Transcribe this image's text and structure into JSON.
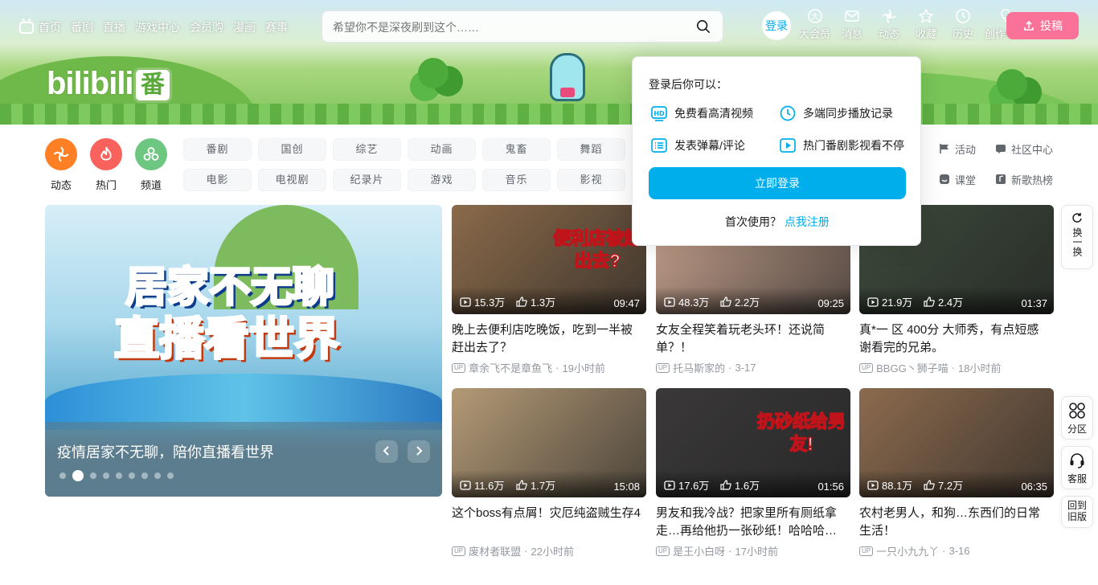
{
  "nav": {
    "left_items": [
      "首页",
      "番剧",
      "直播",
      "游戏中心",
      "会员购",
      "漫画",
      "赛事"
    ],
    "search_placeholder": "希望你不是深夜刷到这个……",
    "login_avatar": "登录",
    "right_items": [
      {
        "label": "大会员",
        "icon": "vip-icon"
      },
      {
        "label": "消息",
        "icon": "message-icon"
      },
      {
        "label": "动态",
        "icon": "dynamic-icon"
      },
      {
        "label": "收藏",
        "icon": "favorite-icon"
      },
      {
        "label": "历史",
        "icon": "history-icon"
      },
      {
        "label": "创作中心",
        "icon": "creator-center-icon"
      }
    ],
    "upload_label": "投稿"
  },
  "logo": {
    "text": "bilibili",
    "badge": "番"
  },
  "channels": {
    "round": [
      {
        "label": "动态",
        "color": "#ff7f24",
        "icon": "dynamic-icon"
      },
      {
        "label": "热门",
        "color": "#f9625c",
        "icon": "fire-icon"
      },
      {
        "label": "频道",
        "color": "#6dc781",
        "icon": "channel-icon"
      }
    ],
    "categories": [
      "番剧",
      "国创",
      "综艺",
      "动画",
      "鬼畜",
      "舞蹈",
      "电影",
      "电视剧",
      "纪录片",
      "游戏",
      "音乐",
      "影视"
    ],
    "side_links": [
      "活动",
      "社区中心",
      "课堂",
      "新歌热榜"
    ]
  },
  "carousel": {
    "caption": "疫情居家不无聊，陪你直播看世界",
    "headline1": "居家不无聊",
    "headline2": "直播看世界",
    "dot_count": 9,
    "active_dot": 1
  },
  "videos": [
    {
      "title": "晚上去便利店吃晚饭，吃到一半被赶出去了？",
      "views": "15.3万",
      "likes": "1.3万",
      "duration": "09:47",
      "author": "章余飞不是章鱼飞",
      "time": "19小时前",
      "thumb_text": "便利店被赶出去?",
      "bg": "#8a6a4a"
    },
    {
      "title": "女友全程笑着玩老头环！还说简单？！",
      "views": "48.3万",
      "likes": "2.2万",
      "duration": "09:25",
      "author": "托马斯家的",
      "time": "3-17",
      "thumb_text": "",
      "bg": "#c9a48f"
    },
    {
      "title": "真*一 区 400分 大师秀，有点短感谢看完的兄弟。",
      "views": "21.9万",
      "likes": "2.4万",
      "duration": "01:37",
      "author": "BBGG丶狮子喵",
      "time": "18小时前",
      "thumb_text": "",
      "bg": "#3c4a3a"
    },
    {
      "title": "这个boss有点屑！灾厄纯盗贼生存4",
      "views": "11.6万",
      "likes": "1.7万",
      "duration": "15:08",
      "author": "废材者联盟",
      "time": "22小时前",
      "thumb_text": "",
      "bg": "#b49a76"
    },
    {
      "title": "男友和我冷战？把家里所有厕纸拿走…再给他扔一张砂纸！哈哈哈…",
      "views": "17.6万",
      "likes": "1.6万",
      "duration": "01:56",
      "author": "是王小白呀",
      "time": "17小时前",
      "thumb_text": "扔砂纸给男友!",
      "bg": "#3a3838"
    },
    {
      "title": "农村老男人，和狗…东西们的日常生活！",
      "views": "88.1万",
      "likes": "7.2万",
      "duration": "06:35",
      "author": "一只小九九丫",
      "time": "3-16",
      "thumb_text": "",
      "bg": "#8c6b4e"
    }
  ],
  "popup": {
    "heading": "登录后你可以：",
    "features": [
      {
        "label": "免费看高清视频",
        "icon": "hd-icon"
      },
      {
        "label": "多端同步播放记录",
        "icon": "clock-icon"
      },
      {
        "label": "发表弹幕/评论",
        "icon": "comment-list-icon"
      },
      {
        "label": "热门番剧影视看不停",
        "icon": "play-icon"
      }
    ],
    "login_button": "立即登录",
    "register_prompt": "首次使用？",
    "register_link": "点我注册"
  },
  "float_buttons": {
    "refresh": "换一换",
    "zone": "分区",
    "service": "客服",
    "old_version": "回到旧版"
  },
  "colors": {
    "accent": "#00aeec",
    "pink": "#fb7299"
  }
}
